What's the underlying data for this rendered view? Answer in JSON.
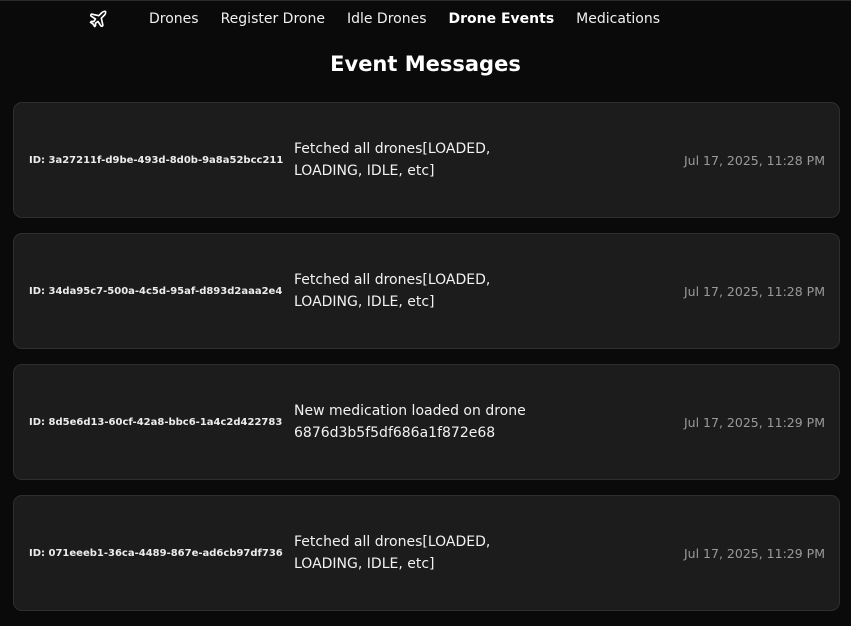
{
  "nav": {
    "logo_icon": "airplane-icon",
    "items": [
      {
        "label": "Drones",
        "active": false
      },
      {
        "label": "Register Drone",
        "active": false
      },
      {
        "label": "Idle Drones",
        "active": false
      },
      {
        "label": "Drone Events",
        "active": true
      },
      {
        "label": "Medications",
        "active": false
      }
    ]
  },
  "page": {
    "title": "Event Messages"
  },
  "events": [
    {
      "id": "ID: 3a27211f-d9be-493d-8d0b-9a8a52bcc211",
      "message": "Fetched all drones[LOADED, LOADING, IDLE, etc]",
      "time": "Jul 17, 2025, 11:28 PM"
    },
    {
      "id": "ID: 34da95c7-500a-4c5d-95af-d893d2aaa2e4",
      "message": "Fetched all drones[LOADED, LOADING, IDLE, etc]",
      "time": "Jul 17, 2025, 11:28 PM"
    },
    {
      "id": "ID: 8d5e6d13-60cf-42a8-bbc6-1a4c2d422783",
      "message": "New medication loaded on drone 6876d3b5f5df686a1f872e68",
      "time": "Jul 17, 2025, 11:29 PM"
    },
    {
      "id": "ID: 071eeeb1-36ca-4489-867e-ad6cb97df736",
      "message": "Fetched all drones[LOADED, LOADING, IDLE, etc]",
      "time": "Jul 17, 2025, 11:29 PM"
    }
  ]
}
